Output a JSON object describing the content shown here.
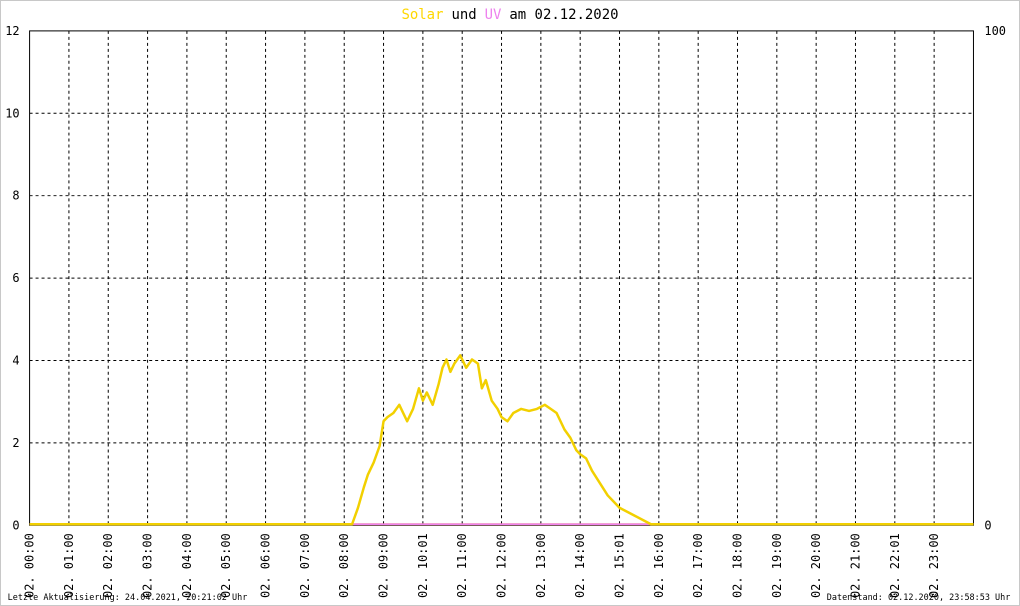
{
  "title": {
    "part1": "Solar",
    "part2": "und",
    "part3": "UV",
    "part4": "am 02.12.2020"
  },
  "footer": {
    "left": "Letzte Aktualisierung: 24.04.2021, 20:21:02 Uhr",
    "right": "Datenstand: 02.12.2020, 23:58:53 Uhr"
  },
  "colors": {
    "solar": "#ffd700",
    "solar_line": "#f2d000",
    "uv": "#ee82ee",
    "baseline": "#f08070",
    "grid": "#000000"
  },
  "chart_data": {
    "type": "line",
    "title": "Solar und UV am 02.12.2020",
    "grid": true,
    "x": {
      "ticks": [
        "02. 00:00",
        "02. 01:00",
        "02. 02:00",
        "02. 03:00",
        "02. 04:00",
        "02. 05:00",
        "02. 06:00",
        "02. 07:00",
        "02. 08:00",
        "02. 09:00",
        "02. 10:01",
        "02. 11:00",
        "02. 12:00",
        "02. 13:00",
        "02. 14:00",
        "02. 15:01",
        "02. 16:00",
        "02. 17:00",
        "02. 18:00",
        "02. 19:00",
        "02. 20:00",
        "02. 21:00",
        "02. 22:01",
        "02. 23:00"
      ],
      "range_hours": [
        0,
        24
      ]
    },
    "y_left": {
      "ticks": [
        "0",
        "2",
        "4",
        "6",
        "8",
        "10",
        "12"
      ],
      "lim": [
        0,
        12
      ]
    },
    "y_right": {
      "ticks": [
        "0",
        "100"
      ],
      "lim": [
        0,
        100
      ]
    },
    "series": [
      {
        "name": "Solar",
        "x_hours": [
          0,
          8.2,
          8.35,
          8.5,
          8.6,
          8.75,
          8.9,
          9.0,
          9.1,
          9.25,
          9.4,
          9.5,
          9.6,
          9.75,
          9.9,
          10.0,
          10.1,
          10.25,
          10.4,
          10.5,
          10.6,
          10.7,
          10.8,
          10.95,
          11.1,
          11.25,
          11.4,
          11.5,
          11.6,
          11.75,
          11.9,
          12.0,
          12.15,
          12.3,
          12.5,
          12.7,
          12.9,
          13.0,
          13.1,
          13.25,
          13.4,
          13.5,
          13.6,
          13.75,
          13.9,
          14.0,
          14.15,
          14.3,
          14.5,
          14.7,
          14.9,
          15.0,
          15.2,
          15.4,
          15.6,
          15.8,
          24
        ],
        "values": [
          0,
          0,
          0.4,
          0.9,
          1.2,
          1.5,
          1.9,
          2.5,
          2.6,
          2.7,
          2.9,
          2.7,
          2.5,
          2.8,
          3.3,
          3.0,
          3.2,
          2.9,
          3.4,
          3.8,
          4.0,
          3.7,
          3.9,
          4.1,
          3.8,
          4.0,
          3.9,
          3.3,
          3.5,
          3.0,
          2.8,
          2.6,
          2.5,
          2.7,
          2.8,
          2.75,
          2.8,
          2.85,
          2.9,
          2.8,
          2.7,
          2.5,
          2.3,
          2.1,
          1.8,
          1.7,
          1.6,
          1.3,
          1.0,
          0.7,
          0.5,
          0.4,
          0.3,
          0.2,
          0.1,
          0,
          0
        ]
      },
      {
        "name": "UV",
        "x_hours": [
          0,
          24
        ],
        "values": [
          0,
          0
        ]
      }
    ]
  }
}
